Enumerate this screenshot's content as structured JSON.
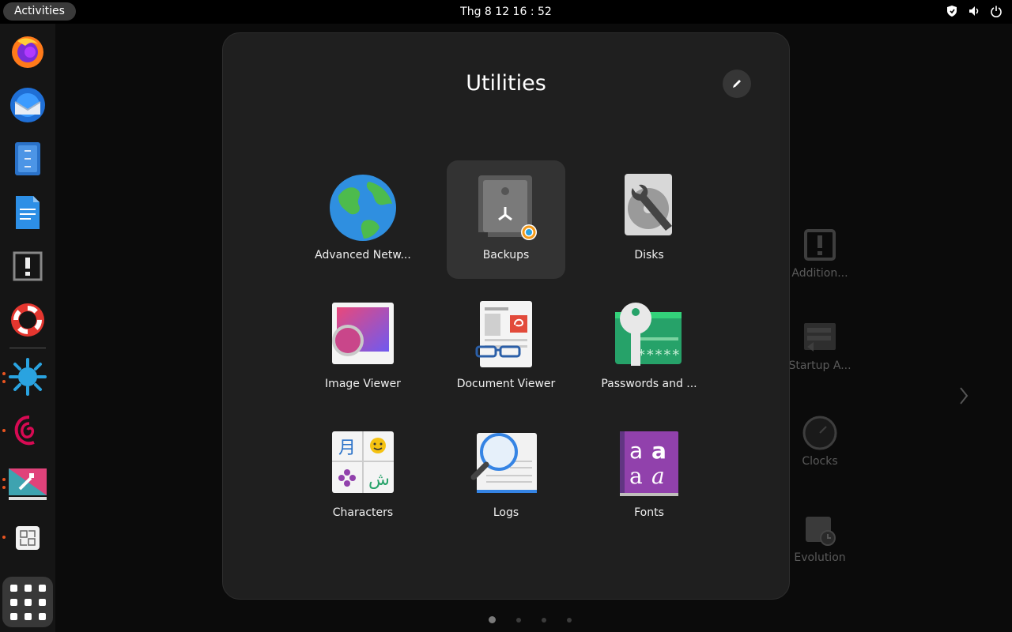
{
  "topbar": {
    "activities_label": "Activities",
    "clock": "Thg 8 12  16 : 52",
    "tray_icons": [
      "shield-icon",
      "volume-icon",
      "power-icon"
    ]
  },
  "dock": {
    "apps": [
      "firefox-icon",
      "thunderbird-icon",
      "files-icon",
      "writer-icon",
      "error-reporter-icon",
      "help-icon",
      "splash-app-icon",
      "debian-icon",
      "installer-icon",
      "screenshot-icon"
    ],
    "show_apps_icon": "app-grid-icon"
  },
  "folder": {
    "title": "Utilities",
    "apps": [
      {
        "label": "Advanced Netw...",
        "icon": "globe-icon"
      },
      {
        "label": "Backups",
        "icon": "safe-icon"
      },
      {
        "label": "Disks",
        "icon": "disk-wrench-icon"
      },
      {
        "label": "Image Viewer",
        "icon": "image-viewer-icon"
      },
      {
        "label": "Document Viewer",
        "icon": "document-viewer-icon"
      },
      {
        "label": "Passwords and ...",
        "icon": "key-icon"
      },
      {
        "label": "Characters",
        "icon": "characters-icon"
      },
      {
        "label": "Logs",
        "icon": "logs-magnifier-icon"
      },
      {
        "label": "Fonts",
        "icon": "fonts-icon"
      }
    ]
  },
  "background_apps": [
    {
      "label": "Addition..."
    },
    {
      "label": "Startup A..."
    },
    {
      "label": "Clocks"
    },
    {
      "label": "Evolution"
    }
  ],
  "pager": {
    "pages": 4,
    "current": 1
  }
}
